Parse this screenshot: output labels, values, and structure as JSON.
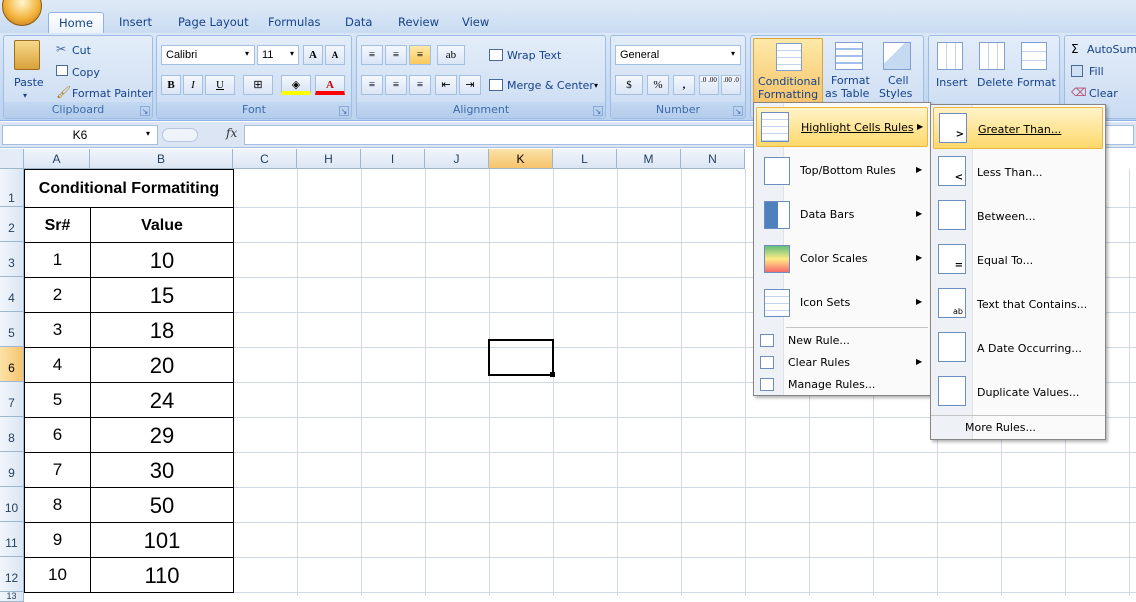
{
  "tabs": [
    "Home",
    "Insert",
    "Page Layout",
    "Formulas",
    "Data",
    "Review",
    "View"
  ],
  "clipboard": {
    "paste": "Paste",
    "cut": "Cut",
    "copy": "Copy",
    "format_painter": "Format Painter",
    "label": "Clipboard"
  },
  "font": {
    "name": "Calibri",
    "size": "11",
    "bold": "B",
    "italic": "I",
    "underline": "U",
    "label": "Font",
    "grow": "A",
    "shrink": "A",
    "font_color": "A"
  },
  "alignment": {
    "wrap_text": "Wrap Text",
    "merge_center": "Merge & Center",
    "label": "Alignment"
  },
  "number": {
    "format": "General",
    "currency": "$",
    "percent": "%",
    "comma": ",",
    "inc": ".0 .00",
    "dec": ".00 .0",
    "label": "Number"
  },
  "styles": {
    "cf_line1": "Conditional",
    "cf_line2": "Formatting",
    "fat_line1": "Format",
    "fat_line2": "as Table",
    "cs_line1": "Cell",
    "cs_line2": "Styles"
  },
  "cells_group": {
    "insert": "Insert",
    "delete": "Delete",
    "format": "Format"
  },
  "editing": {
    "autosum": "AutoSum",
    "fill": "Fill",
    "clear": "Clear"
  },
  "formula_bar": {
    "name_box": "K6",
    "fx": "fx"
  },
  "columns": [
    "A",
    "B",
    "C",
    "H",
    "I",
    "J",
    "K",
    "L",
    "M",
    "N"
  ],
  "rows": [
    "1",
    "2",
    "3",
    "4",
    "5",
    "6",
    "7",
    "8",
    "9",
    "10",
    "11",
    "12",
    "13"
  ],
  "sheet": {
    "title": "Conditional Formatiting",
    "headers": [
      "Sr#",
      "Value"
    ],
    "data": [
      [
        "1",
        "10"
      ],
      [
        "2",
        "15"
      ],
      [
        "3",
        "18"
      ],
      [
        "4",
        "20"
      ],
      [
        "5",
        "24"
      ],
      [
        "6",
        "29"
      ],
      [
        "7",
        "30"
      ],
      [
        "8",
        "50"
      ],
      [
        "9",
        "101"
      ],
      [
        "10",
        "110"
      ]
    ]
  },
  "cf_menu": {
    "highlight": "Highlight Cells Rules",
    "topbottom": "Top/Bottom Rules",
    "databars": "Data Bars",
    "colorscales": "Color Scales",
    "iconsets": "Icon Sets",
    "newrule": "New Rule...",
    "clearrules": "Clear Rules",
    "managerules": "Manage Rules..."
  },
  "submenu": {
    "greater": "Greater Than...",
    "less": "Less Than...",
    "between": "Between...",
    "equal": "Equal To...",
    "textcontains": "Text that Contains...",
    "dateoccurring": "A Date Occurring...",
    "duplicate": "Duplicate Values...",
    "more": "More Rules..."
  },
  "colors": {
    "accent": "#15428b",
    "highlight": "#fdd96b",
    "selected_header": "#f6c46b"
  }
}
